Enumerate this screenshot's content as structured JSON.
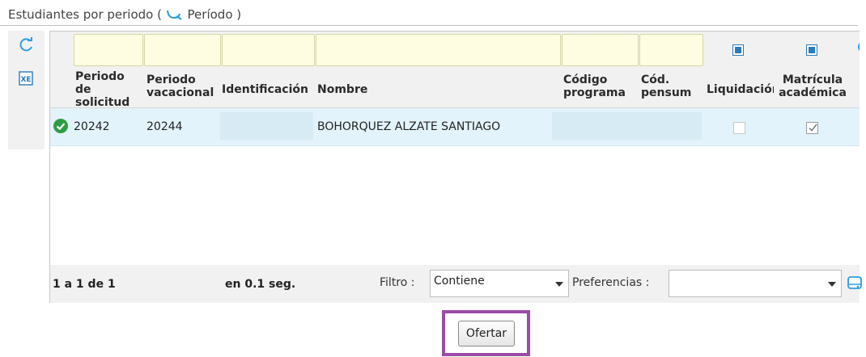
{
  "section": {
    "title_prefix": "Estudiantes por periodo (",
    "period_link": "Período",
    "title_suffix": ")"
  },
  "toolbar": {
    "refresh_icon": "refresh-icon",
    "excel_icon": "excel-export-icon",
    "excel_text": "XE"
  },
  "grid": {
    "columns": [
      {
        "line1": "Periodo",
        "line2": "de",
        "line3": "solicitud"
      },
      {
        "line1": "Periodo",
        "line2": "vacacional"
      },
      {
        "line1": "Identificación"
      },
      {
        "line1": "Nombre"
      },
      {
        "line1": "Código",
        "line2": "programa"
      },
      {
        "line1": "Cód.",
        "line2": "pensum"
      },
      {
        "line1": "Liquidación"
      },
      {
        "line1": "Matrícula",
        "line2": "académica"
      }
    ],
    "rows": [
      {
        "status_icon": "check-circle-icon",
        "periodo_solicitud": "20242",
        "periodo_vacacional": "20244",
        "identificacion": "",
        "nombre": "BOHORQUEZ ALZATE SANTIAGO",
        "codigo_programa": "",
        "cod_pensum": "",
        "liquidacion": false,
        "matricula_academica": true
      }
    ]
  },
  "footer": {
    "pager": "1 a 1 de 1",
    "timing": "en 0.1 seg.",
    "filter_label": "Filtro :",
    "filter_value": "Contiene",
    "preferences_label": "Preferencias :",
    "preferences_value": ""
  },
  "actions": {
    "ofertar_label": "Ofertar"
  },
  "colors": {
    "accent": "#2b7bb9",
    "row_selected": "#e3f3fb",
    "filter_bg": "#fefde1",
    "success": "#2e9e45",
    "highlight": "#9b4ba8"
  }
}
